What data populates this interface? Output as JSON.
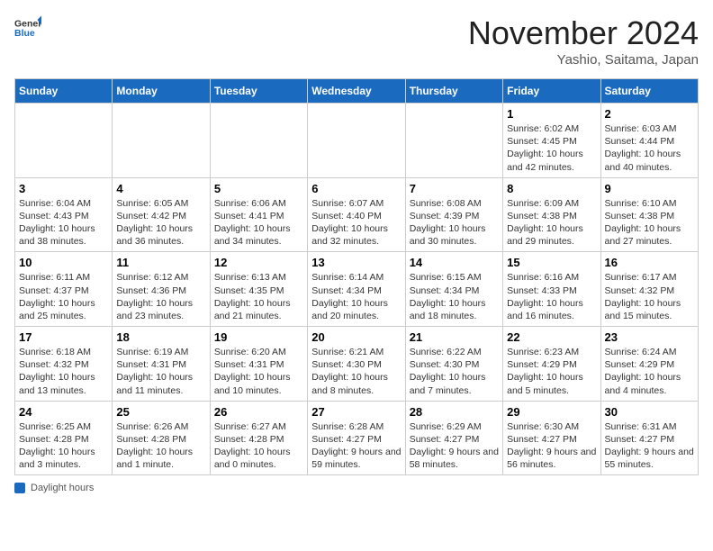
{
  "header": {
    "logo_general": "General",
    "logo_blue": "Blue",
    "month_title": "November 2024",
    "location": "Yashio, Saitama, Japan"
  },
  "days_of_week": [
    "Sunday",
    "Monday",
    "Tuesday",
    "Wednesday",
    "Thursday",
    "Friday",
    "Saturday"
  ],
  "weeks": [
    [
      {
        "day": "",
        "info": ""
      },
      {
        "day": "",
        "info": ""
      },
      {
        "day": "",
        "info": ""
      },
      {
        "day": "",
        "info": ""
      },
      {
        "day": "",
        "info": ""
      },
      {
        "day": "1",
        "info": "Sunrise: 6:02 AM\nSunset: 4:45 PM\nDaylight: 10 hours and 42 minutes."
      },
      {
        "day": "2",
        "info": "Sunrise: 6:03 AM\nSunset: 4:44 PM\nDaylight: 10 hours and 40 minutes."
      }
    ],
    [
      {
        "day": "3",
        "info": "Sunrise: 6:04 AM\nSunset: 4:43 PM\nDaylight: 10 hours and 38 minutes."
      },
      {
        "day": "4",
        "info": "Sunrise: 6:05 AM\nSunset: 4:42 PM\nDaylight: 10 hours and 36 minutes."
      },
      {
        "day": "5",
        "info": "Sunrise: 6:06 AM\nSunset: 4:41 PM\nDaylight: 10 hours and 34 minutes."
      },
      {
        "day": "6",
        "info": "Sunrise: 6:07 AM\nSunset: 4:40 PM\nDaylight: 10 hours and 32 minutes."
      },
      {
        "day": "7",
        "info": "Sunrise: 6:08 AM\nSunset: 4:39 PM\nDaylight: 10 hours and 30 minutes."
      },
      {
        "day": "8",
        "info": "Sunrise: 6:09 AM\nSunset: 4:38 PM\nDaylight: 10 hours and 29 minutes."
      },
      {
        "day": "9",
        "info": "Sunrise: 6:10 AM\nSunset: 4:38 PM\nDaylight: 10 hours and 27 minutes."
      }
    ],
    [
      {
        "day": "10",
        "info": "Sunrise: 6:11 AM\nSunset: 4:37 PM\nDaylight: 10 hours and 25 minutes."
      },
      {
        "day": "11",
        "info": "Sunrise: 6:12 AM\nSunset: 4:36 PM\nDaylight: 10 hours and 23 minutes."
      },
      {
        "day": "12",
        "info": "Sunrise: 6:13 AM\nSunset: 4:35 PM\nDaylight: 10 hours and 21 minutes."
      },
      {
        "day": "13",
        "info": "Sunrise: 6:14 AM\nSunset: 4:34 PM\nDaylight: 10 hours and 20 minutes."
      },
      {
        "day": "14",
        "info": "Sunrise: 6:15 AM\nSunset: 4:34 PM\nDaylight: 10 hours and 18 minutes."
      },
      {
        "day": "15",
        "info": "Sunrise: 6:16 AM\nSunset: 4:33 PM\nDaylight: 10 hours and 16 minutes."
      },
      {
        "day": "16",
        "info": "Sunrise: 6:17 AM\nSunset: 4:32 PM\nDaylight: 10 hours and 15 minutes."
      }
    ],
    [
      {
        "day": "17",
        "info": "Sunrise: 6:18 AM\nSunset: 4:32 PM\nDaylight: 10 hours and 13 minutes."
      },
      {
        "day": "18",
        "info": "Sunrise: 6:19 AM\nSunset: 4:31 PM\nDaylight: 10 hours and 11 minutes."
      },
      {
        "day": "19",
        "info": "Sunrise: 6:20 AM\nSunset: 4:31 PM\nDaylight: 10 hours and 10 minutes."
      },
      {
        "day": "20",
        "info": "Sunrise: 6:21 AM\nSunset: 4:30 PM\nDaylight: 10 hours and 8 minutes."
      },
      {
        "day": "21",
        "info": "Sunrise: 6:22 AM\nSunset: 4:30 PM\nDaylight: 10 hours and 7 minutes."
      },
      {
        "day": "22",
        "info": "Sunrise: 6:23 AM\nSunset: 4:29 PM\nDaylight: 10 hours and 5 minutes."
      },
      {
        "day": "23",
        "info": "Sunrise: 6:24 AM\nSunset: 4:29 PM\nDaylight: 10 hours and 4 minutes."
      }
    ],
    [
      {
        "day": "24",
        "info": "Sunrise: 6:25 AM\nSunset: 4:28 PM\nDaylight: 10 hours and 3 minutes."
      },
      {
        "day": "25",
        "info": "Sunrise: 6:26 AM\nSunset: 4:28 PM\nDaylight: 10 hours and 1 minute."
      },
      {
        "day": "26",
        "info": "Sunrise: 6:27 AM\nSunset: 4:28 PM\nDaylight: 10 hours and 0 minutes."
      },
      {
        "day": "27",
        "info": "Sunrise: 6:28 AM\nSunset: 4:27 PM\nDaylight: 9 hours and 59 minutes."
      },
      {
        "day": "28",
        "info": "Sunrise: 6:29 AM\nSunset: 4:27 PM\nDaylight: 9 hours and 58 minutes."
      },
      {
        "day": "29",
        "info": "Sunrise: 6:30 AM\nSunset: 4:27 PM\nDaylight: 9 hours and 56 minutes."
      },
      {
        "day": "30",
        "info": "Sunrise: 6:31 AM\nSunset: 4:27 PM\nDaylight: 9 hours and 55 minutes."
      }
    ]
  ],
  "footer": {
    "label": "Daylight hours"
  }
}
